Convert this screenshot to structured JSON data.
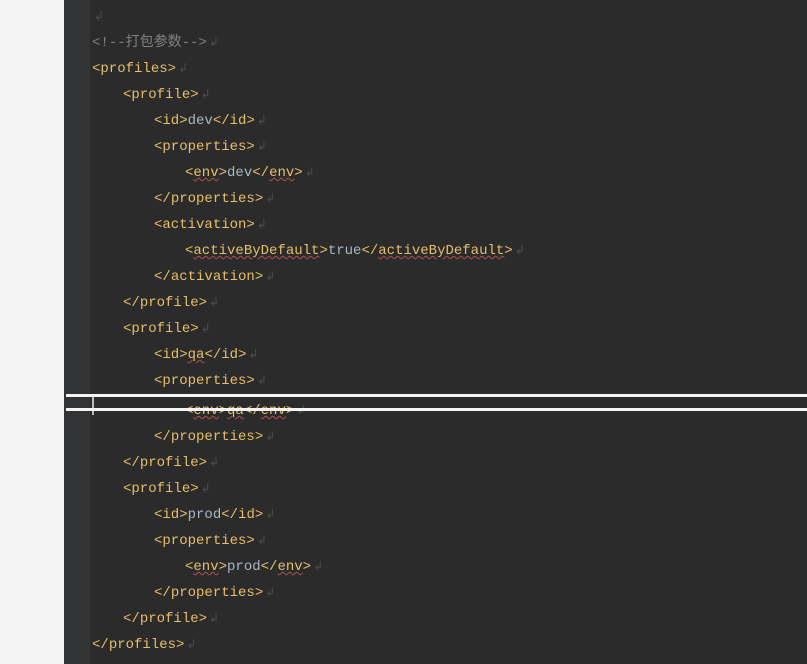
{
  "code": {
    "crlf": "↲",
    "comment_open": "<!--",
    "comment_text": "打包参数",
    "comment_close": "-->",
    "tags": {
      "profiles_open": "profiles",
      "profiles_close": "profiles",
      "profile_open": "profile",
      "profile_close": "profile",
      "id_open": "id",
      "id_close": "id",
      "properties_open": "properties",
      "properties_close": "properties",
      "env_open": "env",
      "env_close": "env",
      "activation_open": "activation",
      "activation_close": "activation",
      "activeByDefault_open": "activeByDefault",
      "activeByDefault_close": "activeByDefault"
    },
    "values": {
      "dev": "dev",
      "qa": "qa",
      "prod": "prod",
      "true": "true"
    }
  }
}
